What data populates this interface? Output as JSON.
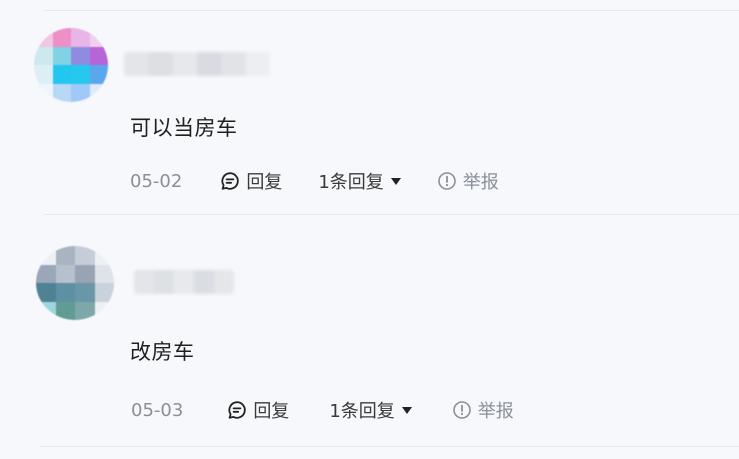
{
  "comments": [
    {
      "content": "可以当房车",
      "date": "05-02",
      "reply_label": "回复",
      "replies_label": "1条回复",
      "report_label": "举报"
    },
    {
      "content": "改房车",
      "date": "05-03",
      "reply_label": "回复",
      "replies_label": "1条回复",
      "report_label": "举报"
    }
  ],
  "icons": {
    "reply": "chat-bubble-icon",
    "expand": "caret-down-icon",
    "report": "warning-circle-icon"
  },
  "colors": {
    "background": "#f7f8fb",
    "muted": "#8a8f99",
    "divider": "#e6e8ec"
  }
}
